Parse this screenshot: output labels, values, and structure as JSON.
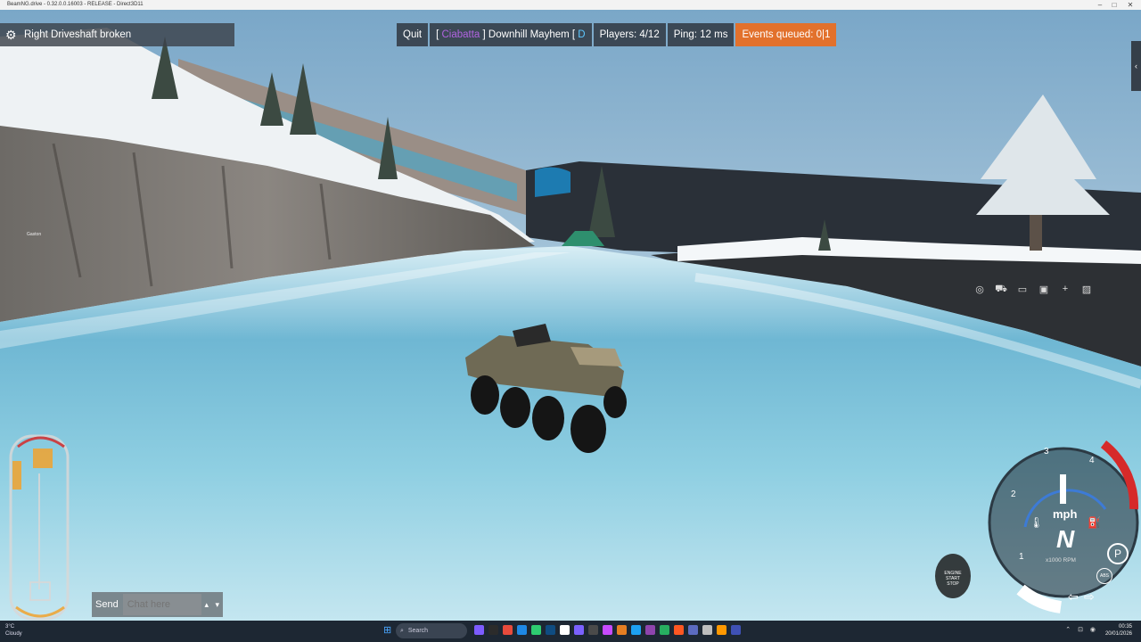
{
  "window": {
    "title": "BeamNG.drive - 0.32.0.0.16003 - RELEASE - Direct3D11",
    "minimize": "–",
    "maximize": "□",
    "close": "✕"
  },
  "notification": {
    "text": "Right Driveshaft broken",
    "icon": "gear-icon"
  },
  "hud": {
    "quit": "Quit",
    "server_prefix": "[",
    "server_tag": "Ciabatta",
    "server_name": "] Downhill Mayhem [",
    "server_suffix": "D",
    "players": "Players: 4/12",
    "ping": "Ping: 12 ms",
    "events": "Events queued: 0|1",
    "events_color": "#e2712c"
  },
  "side_tab": {
    "icon": "chevron-left-icon",
    "glyph": "‹"
  },
  "camera_toolbar": {
    "icons": [
      "target-icon",
      "car-icon",
      "photo-icon",
      "window-icon",
      "plus-icon",
      "image-icon"
    ],
    "glyphs": [
      "◎",
      "⛟",
      "▭",
      "▣",
      "+",
      "▨"
    ]
  },
  "player_tag": {
    "text": "Gaston"
  },
  "chat": {
    "send_label": "Send",
    "placeholder": "Chat here",
    "arrow_up": "▴",
    "arrow_down": "▾"
  },
  "gauge": {
    "unit": "mph",
    "rpm_label": "x1000 RPM",
    "gear": "N",
    "speed": "1",
    "ticks": [
      "1",
      "2",
      "3",
      "4"
    ],
    "parking": "P",
    "abs": "ABS",
    "accent": "#d62a2a",
    "needle_rpm": 0.0
  },
  "engine_button": {
    "top": "ENGINE",
    "mid": "START",
    "bot": "STOP"
  },
  "taskbar": {
    "weather_temp": "3°C",
    "weather_text": "Cloudy",
    "search_placeholder": "Search",
    "time": "00:35",
    "date": "20/01/2026",
    "app_colors": [
      "#7d5cff",
      "#2b2b2b",
      "#e84b3c",
      "#1e88e5",
      "#2ecc71",
      "#0f4c81",
      "#ffffff",
      "#7b61ff",
      "#4a4a4a",
      "#c74bff",
      "#e67e22",
      "#1da1f2",
      "#8e44ad",
      "#27ae60",
      "#ff5722",
      "#5c6bc0",
      "#bdbdbd",
      "#ff9800",
      "#3f51b5"
    ]
  }
}
